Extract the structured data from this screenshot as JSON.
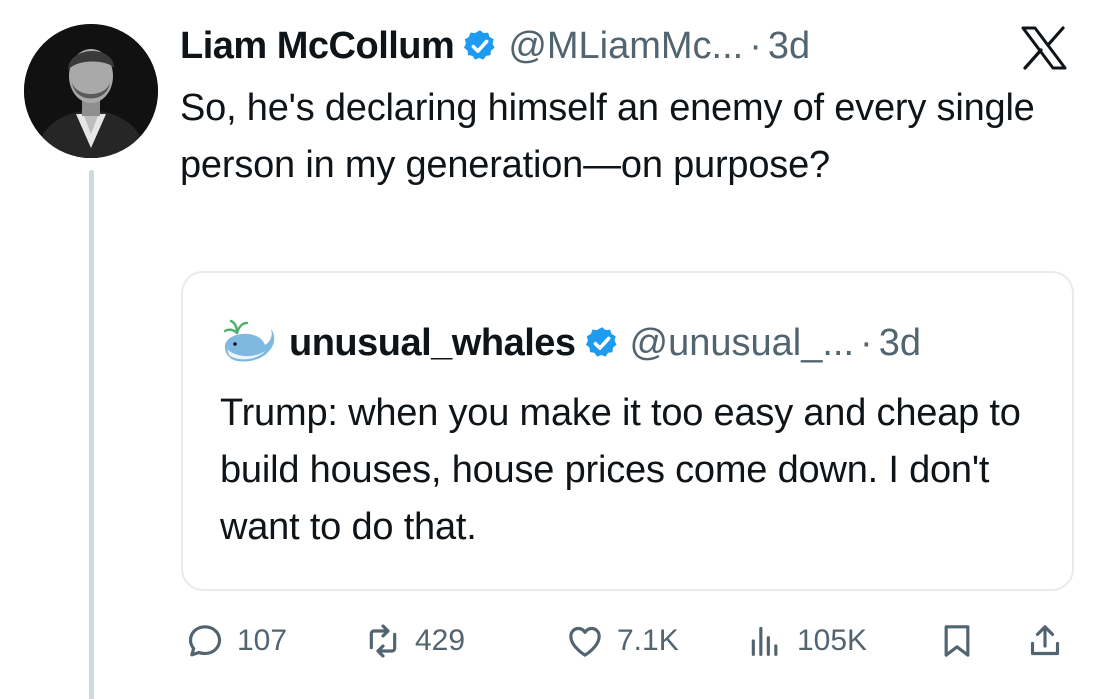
{
  "author": {
    "display_name": "Liam McCollum",
    "handle": "@MLiamMc...",
    "time": "3d",
    "verified": true
  },
  "tweet": {
    "text": "So, he's declaring himself an enemy of every single person in my generation—on purpose?"
  },
  "quoted_tweet": {
    "display_name": "unusual_whales",
    "handle": "@unusual_...",
    "time": "3d",
    "verified": true,
    "text": "Trump: when you make it too easy and cheap to build houses, house prices come down. I don't want to do that."
  },
  "actions": {
    "replies": "107",
    "reposts": "429",
    "likes": "7.1K",
    "views": "105K"
  },
  "separator": "·",
  "icons": [
    "verified-badge-icon",
    "x-logo-icon",
    "reply-icon",
    "repost-icon",
    "like-icon",
    "views-icon",
    "bookmark-icon",
    "share-icon"
  ],
  "colors": {
    "text": "#0f1419",
    "muted": "#536471",
    "verified": "#1d9bf0",
    "border": "#e6ebee",
    "thread_line": "#cfd9de"
  }
}
